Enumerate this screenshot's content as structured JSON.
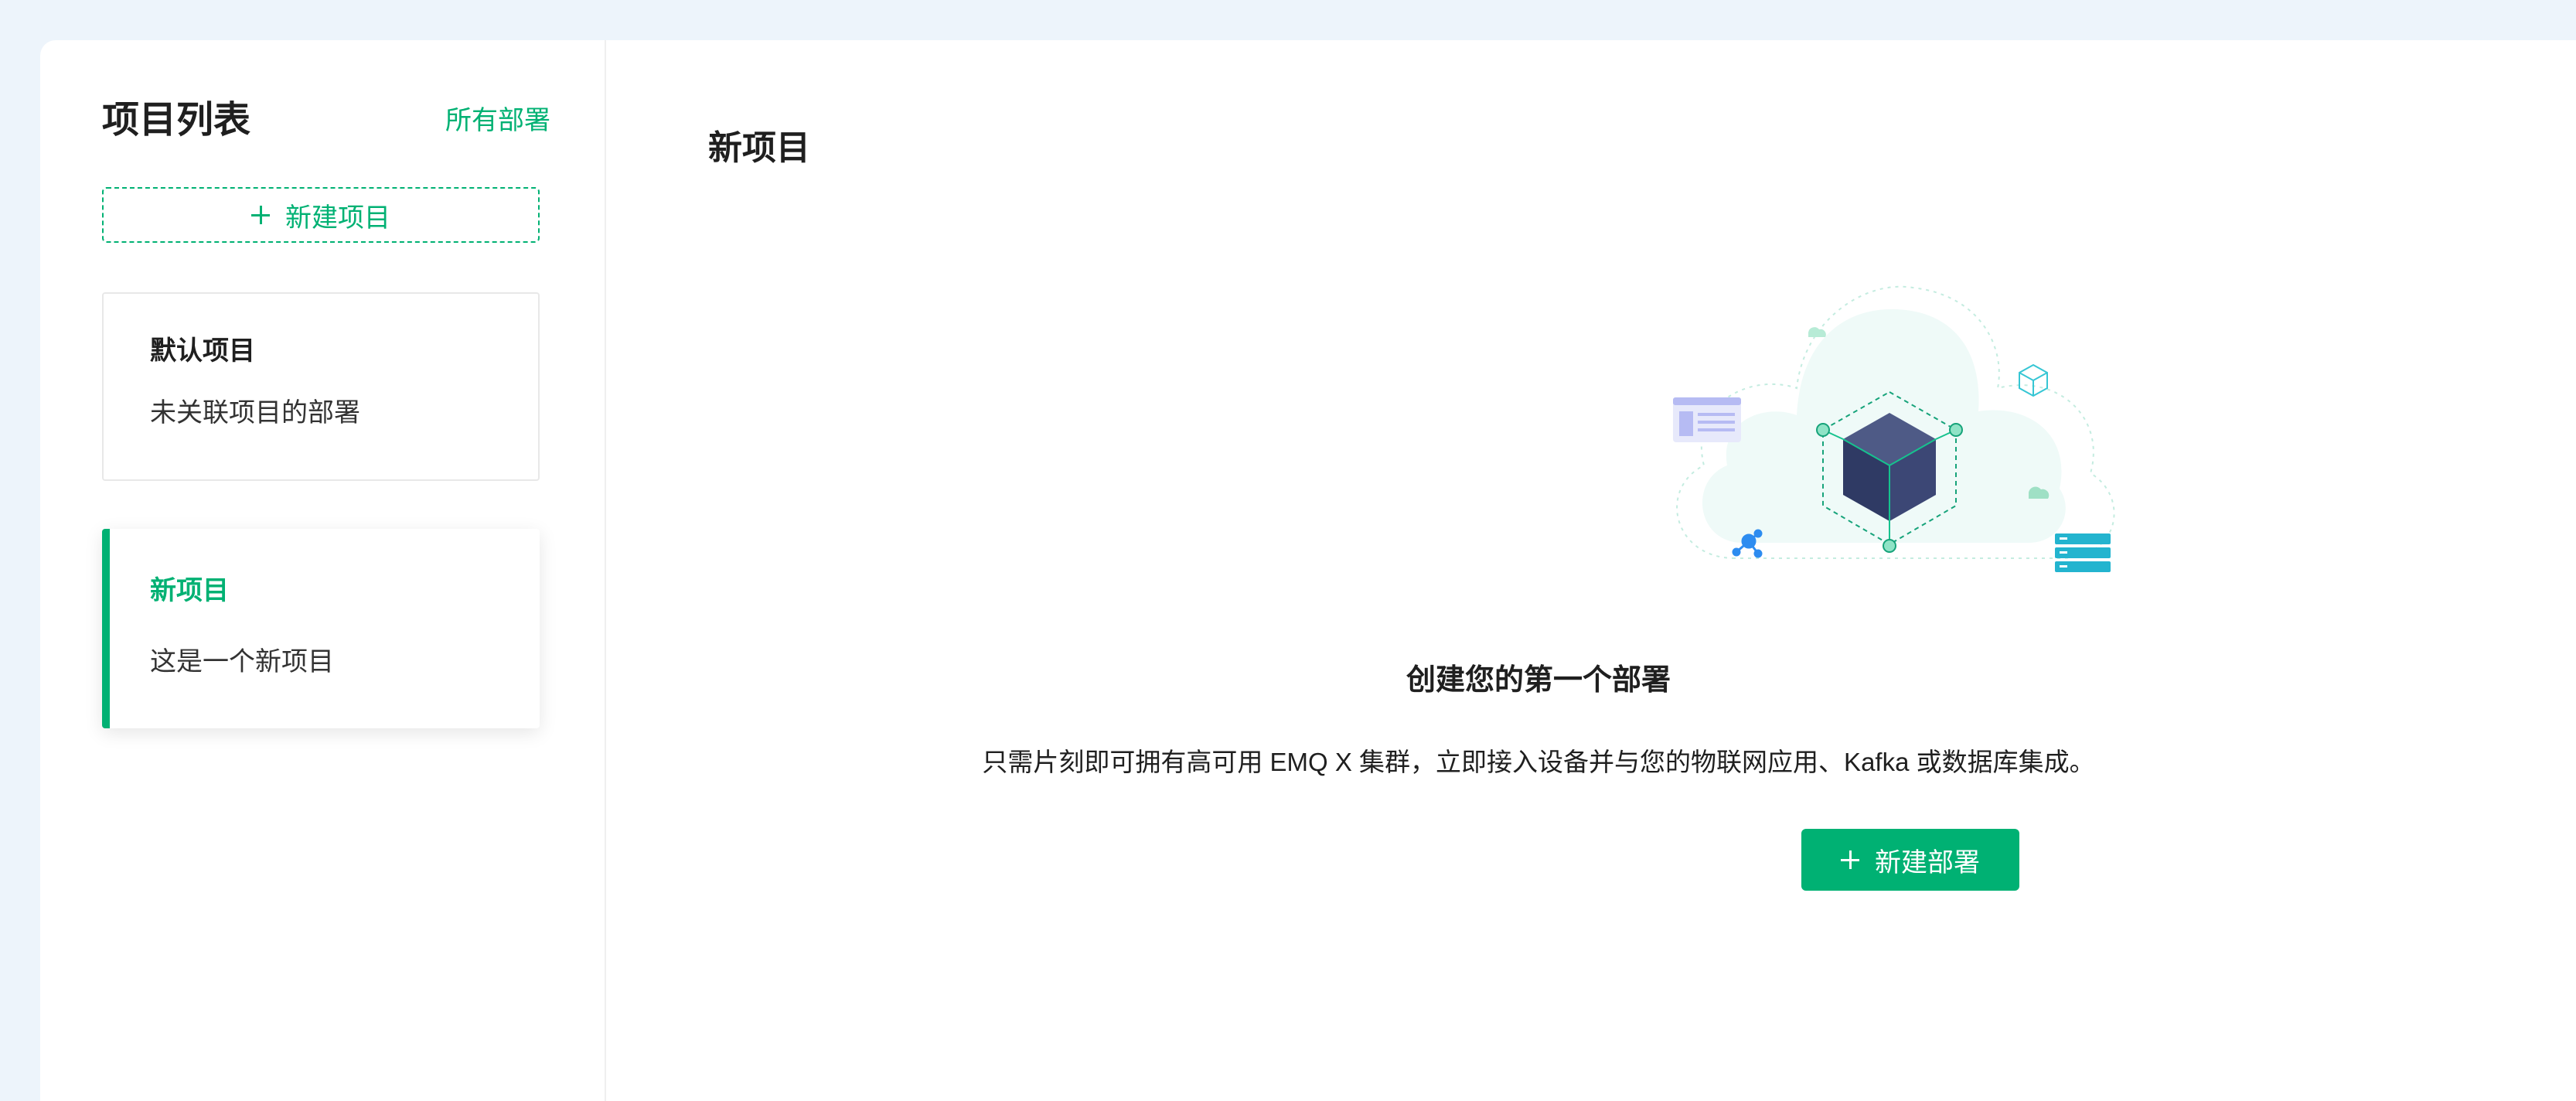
{
  "colors": {
    "accent": "#00b173",
    "page_background": "#edf4fb",
    "card_background": "#ffffff",
    "text_primary": "#1f1f1f"
  },
  "sidebar": {
    "title": "项目列表",
    "all_deployments_link": "所有部署",
    "new_project_button": {
      "icon": "plus-icon",
      "label": "新建项目"
    },
    "projects": [
      {
        "name": "默认项目",
        "description": "未关联项目的部署",
        "selected": false
      },
      {
        "name": "新项目",
        "description": "这是一个新项目",
        "selected": true
      }
    ]
  },
  "main": {
    "title": "新项目",
    "illustration": "cloud-cube-illustration",
    "empty_state": {
      "title": "创建您的第一个部署",
      "description": "只需片刻即可拥有高可用 EMQ X 集群，立即接入设备并与您的物联网应用、Kafka 或数据库集成。",
      "button": {
        "icon": "plus-icon",
        "label": "新建部署"
      }
    }
  }
}
